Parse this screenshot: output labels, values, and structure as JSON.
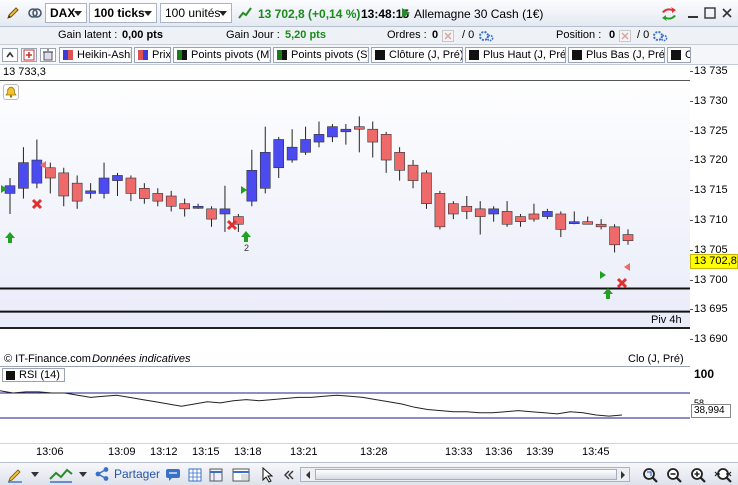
{
  "toolbar": {
    "instrument": "DAX",
    "period": "100 ticks",
    "units": "100 unités",
    "last_price": "13 702,8 (+0,14 %)",
    "time": "13:48:15",
    "market": "Allemagne 30 Cash (1€)"
  },
  "account": {
    "latent_label": "Gain latent :",
    "latent_value": "0,00 pts",
    "day_label": "Gain Jour :",
    "day_value": "5,20 pts",
    "orders_label": "Ordres :",
    "orders_value": "0",
    "orders_total": "/ 0",
    "position_label": "Position :",
    "position_value": "0",
    "position_total": "/ 0"
  },
  "indicators": [
    "Heikin-Ashi",
    "Prix",
    "Points pivots (M)",
    "Points pivots (S)",
    "Clôture (J, Pré)",
    "Plus Haut (J, Pré)",
    "Plus Bas (J, Pré)",
    "C"
  ],
  "chart": {
    "top_value": "13 733,3",
    "last_label": "13 702,8",
    "piv_label": "Piv 4h",
    "clo_label": "Clo (J, Pré)",
    "source": "© IT-Finance.com",
    "source_note": "Données indicatives",
    "badge": "2"
  },
  "price_ticks": [
    "13 735",
    "13 730",
    "13 725",
    "13 720",
    "13 715",
    "13 710",
    "13 705",
    "13 700",
    "13 695",
    "13 690"
  ],
  "rsi": {
    "label": "RSI (14)",
    "max_label": "100",
    "level": "58",
    "value": "38,994"
  },
  "time_labels": [
    "13:06",
    "13:09",
    "13:12",
    "13:15",
    "13:18",
    "13:21",
    "13:28",
    "13:33",
    "13:36",
    "13:39",
    "13:45"
  ],
  "bottom": {
    "share_label": "Partager"
  },
  "colors": {
    "bull": "#4b4bf0",
    "bear": "#ee6a6a",
    "pane_bg": "#e9ecf9",
    "last_price_bg": "#ffff00",
    "up_arrow": "#22a022",
    "cross": "#e03030"
  },
  "chart_data": {
    "type": "candlestick",
    "unit": "points",
    "candles": [
      {
        "o": 13712.0,
        "h": 13715.0,
        "l": 13708.0,
        "c": 13713.5
      },
      {
        "o": 13713.0,
        "h": 13721.0,
        "l": 13711.0,
        "c": 13718.0
      },
      {
        "o": 13714.0,
        "h": 13722.5,
        "l": 13713.0,
        "c": 13718.5
      },
      {
        "o": 13717.0,
        "h": 13718.0,
        "l": 13712.0,
        "c": 13715.0
      },
      {
        "o": 13716.0,
        "h": 13717.0,
        "l": 13709.5,
        "c": 13711.5
      },
      {
        "o": 13714.0,
        "h": 13715.5,
        "l": 13709.0,
        "c": 13710.5
      },
      {
        "o": 13712.0,
        "h": 13714.0,
        "l": 13711.0,
        "c": 13712.5
      },
      {
        "o": 13712.0,
        "h": 13718.0,
        "l": 13711.0,
        "c": 13715.0
      },
      {
        "o": 13714.5,
        "h": 13716.0,
        "l": 13711.5,
        "c": 13715.5
      },
      {
        "o": 13715.0,
        "h": 13715.5,
        "l": 13710.5,
        "c": 13712.0
      },
      {
        "o": 13713.0,
        "h": 13714.0,
        "l": 13710.0,
        "c": 13711.0
      },
      {
        "o": 13712.0,
        "h": 13713.0,
        "l": 13709.5,
        "c": 13710.5
      },
      {
        "o": 13711.5,
        "h": 13712.5,
        "l": 13708.5,
        "c": 13709.5
      },
      {
        "o": 13710.0,
        "h": 13711.0,
        "l": 13707.5,
        "c": 13709.0
      },
      {
        "o": 13709.5,
        "h": 13710.0,
        "l": 13709.0,
        "c": 13709.5
      },
      {
        "o": 13709.0,
        "h": 13709.5,
        "l": 13705.5,
        "c": 13707.0
      },
      {
        "o": 13708.0,
        "h": 13713.5,
        "l": 13704.5,
        "c": 13709.0
      },
      {
        "o": 13707.5,
        "h": 13708.0,
        "l": 13704.5,
        "c": 13706.0
      },
      {
        "o": 13710.5,
        "h": 13720.5,
        "l": 13709.5,
        "c": 13716.5
      },
      {
        "o": 13713.0,
        "h": 13725.0,
        "l": 13712.0,
        "c": 13720.0
      },
      {
        "o": 13717.0,
        "h": 13723.0,
        "l": 13715.0,
        "c": 13722.5
      },
      {
        "o": 13718.5,
        "h": 13724.5,
        "l": 13718.0,
        "c": 13721.0
      },
      {
        "o": 13720.0,
        "h": 13725.0,
        "l": 13719.5,
        "c": 13722.5
      },
      {
        "o": 13722.0,
        "h": 13726.0,
        "l": 13721.0,
        "c": 13723.5
      },
      {
        "o": 13723.0,
        "h": 13725.5,
        "l": 13722.0,
        "c": 13725.0
      },
      {
        "o": 13724.0,
        "h": 13725.5,
        "l": 13721.5,
        "c": 13724.5
      },
      {
        "o": 13725.0,
        "h": 13727.0,
        "l": 13720.0,
        "c": 13724.5
      },
      {
        "o": 13724.5,
        "h": 13726.0,
        "l": 13719.0,
        "c": 13722.0
      },
      {
        "o": 13723.5,
        "h": 13724.0,
        "l": 13716.0,
        "c": 13718.5
      },
      {
        "o": 13720.0,
        "h": 13721.0,
        "l": 13714.5,
        "c": 13716.5
      },
      {
        "o": 13717.5,
        "h": 13718.5,
        "l": 13713.0,
        "c": 13714.5
      },
      {
        "o": 13716.0,
        "h": 13716.5,
        "l": 13709.0,
        "c": 13710.0
      },
      {
        "o": 13712.0,
        "h": 13712.5,
        "l": 13705.0,
        "c": 13705.5
      },
      {
        "o": 13710.0,
        "h": 13710.5,
        "l": 13707.0,
        "c": 13708.0
      },
      {
        "o": 13709.5,
        "h": 13711.5,
        "l": 13707.0,
        "c": 13708.5
      },
      {
        "o": 13709.0,
        "h": 13710.5,
        "l": 13704.0,
        "c": 13707.5
      },
      {
        "o": 13708.0,
        "h": 13709.5,
        "l": 13706.5,
        "c": 13709.0
      },
      {
        "o": 13708.5,
        "h": 13710.5,
        "l": 13705.5,
        "c": 13706.0
      },
      {
        "o": 13707.5,
        "h": 13708.0,
        "l": 13705.5,
        "c": 13706.5
      },
      {
        "o": 13708.0,
        "h": 13710.0,
        "l": 13706.5,
        "c": 13707.0
      },
      {
        "o": 13707.5,
        "h": 13709.0,
        "l": 13707.0,
        "c": 13708.5
      },
      {
        "o": 13708.0,
        "h": 13708.5,
        "l": 13703.5,
        "c": 13705.0
      },
      {
        "o": 13706.5,
        "h": 13708.5,
        "l": 13706.0,
        "c": 13706.5
      },
      {
        "o": 13706.5,
        "h": 13707.5,
        "l": 13706.0,
        "c": 13706.0
      },
      {
        "o": 13706.0,
        "h": 13707.0,
        "l": 13705.0,
        "c": 13705.5
      },
      {
        "o": 13705.5,
        "h": 13706.0,
        "l": 13700.5,
        "c": 13702.0
      },
      {
        "o": 13704.0,
        "h": 13705.0,
        "l": 13702.0,
        "c": 13702.8
      }
    ],
    "ylim": [
      13686,
      13737
    ],
    "reference_lines": [
      {
        "name": "Piv 4h",
        "value": 13693.5
      },
      {
        "name": "Clo (J, Pré)",
        "value": 13689
      }
    ],
    "rsi": [
      72,
      70,
      71,
      71,
      70,
      70,
      68,
      66,
      67,
      68,
      66,
      64,
      62,
      60,
      58,
      60,
      62,
      61,
      63,
      64,
      63,
      64,
      65,
      66,
      66,
      67,
      68,
      67,
      66,
      64,
      62,
      60,
      57,
      55,
      54,
      53,
      53,
      52,
      52,
      53,
      54,
      53,
      52,
      51,
      53,
      52,
      50,
      49,
      50
    ]
  }
}
